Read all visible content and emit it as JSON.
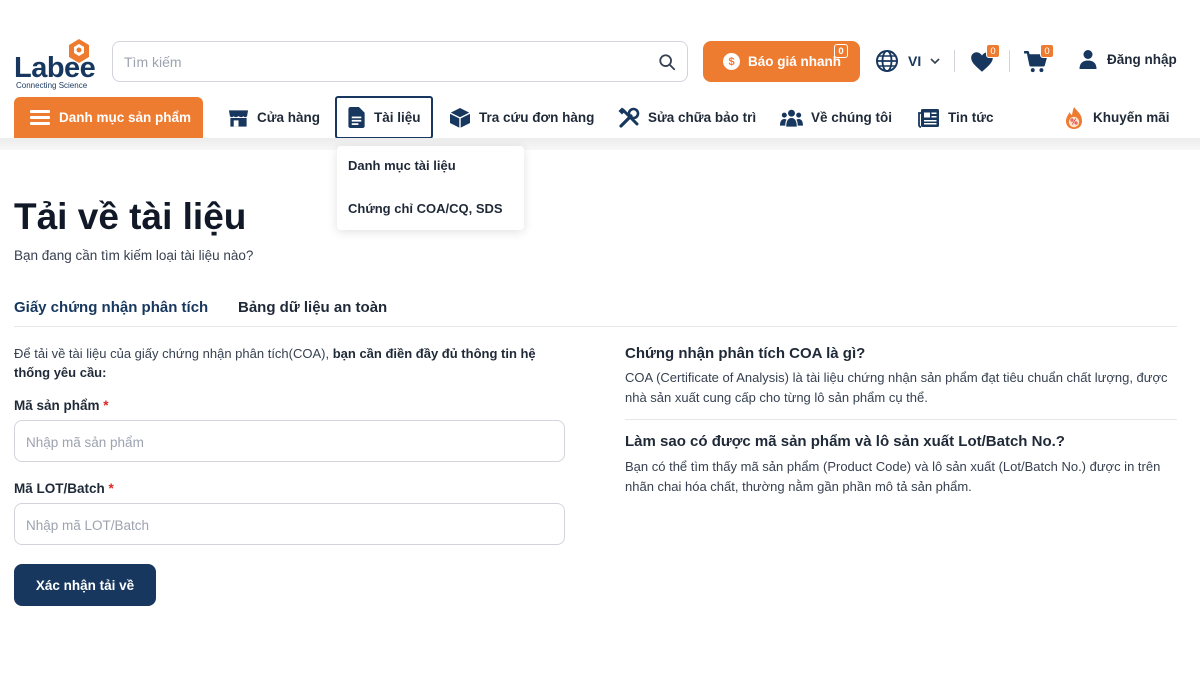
{
  "brand": {
    "name": "Labee",
    "tagline": "Connecting Science",
    "primary_color": "#17375e",
    "accent_color": "#ee7c30"
  },
  "header": {
    "search_placeholder": "Tìm kiếm",
    "search_icon": "search-icon",
    "quote_button": "Báo giá nhanh",
    "quote_badge": "0",
    "language": "VI",
    "wishlist_badge": "0",
    "cart_badge": "0",
    "login": "Đăng nhập"
  },
  "nav": {
    "categories": "Danh mục sản phẩm",
    "items": [
      {
        "label": "Cửa hàng",
        "icon": "store-icon"
      },
      {
        "label": "Tài liệu",
        "icon": "document-icon",
        "active": true
      },
      {
        "label": "Tra cứu đơn hàng",
        "icon": "box-icon"
      },
      {
        "label": "Sửa chữa bảo trì",
        "icon": "tools-icon"
      },
      {
        "label": "Về chúng tôi",
        "icon": "people-icon"
      },
      {
        "label": "Tin tức",
        "icon": "news-icon"
      },
      {
        "label": "Khuyến mãi",
        "icon": "promo-icon"
      }
    ]
  },
  "dropdown": {
    "items": [
      "Danh mục tài liệu",
      "Chứng chỉ COA/CQ, SDS"
    ]
  },
  "main": {
    "title": "Tải về tài liệu",
    "subtitle": "Bạn đang cần tìm kiếm loại tài liệu nào?",
    "tabs": [
      {
        "label": "Giấy chứng nhận phân tích",
        "active": true
      },
      {
        "label": "Bảng dữ liệu an toàn",
        "active": false
      }
    ],
    "intro_plain": "Để tải về tài liệu của giấy chứng nhận phân tích(COA), ",
    "intro_bold": "bạn cần điền đầy đủ thông tin hệ thống yêu cầu:",
    "product_code_label": "Mã sản phẩm",
    "product_code_placeholder": "Nhập mã sản phẩm",
    "lot_label": "Mã LOT/Batch",
    "lot_placeholder": "Nhập mã LOT/Batch",
    "required_mark": "*",
    "submit": "Xác nhận tải về"
  },
  "faq": [
    {
      "q": "Chứng nhận phân tích COA là gì?",
      "a": "COA (Certificate of Analysis) là tài liệu chứng nhận sản phẩm đạt tiêu chuẩn chất lượng, được nhà sản xuất cung cấp cho từng lô sản phẩm cụ thể."
    },
    {
      "q": "Làm sao có được mã sản phẩm và lô sản xuất Lot/Batch No.?",
      "a": "Bạn có thể tìm thấy mã sản phẩm (Product Code) và lô sản xuất (Lot/Batch No.) được in trên nhãn chai hóa chất, thường nằm gần phần mô tả sản phẩm."
    }
  ]
}
